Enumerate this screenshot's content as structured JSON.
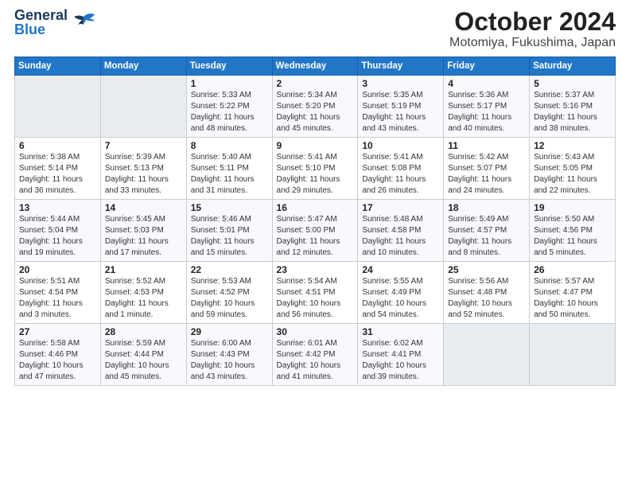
{
  "logo": {
    "name_part1": "General",
    "name_part2": "Blue"
  },
  "title": "October 2024",
  "subtitle": "Motomiya, Fukushima, Japan",
  "weekdays": [
    "Sunday",
    "Monday",
    "Tuesday",
    "Wednesday",
    "Thursday",
    "Friday",
    "Saturday"
  ],
  "weeks": [
    [
      {
        "day": "",
        "detail": ""
      },
      {
        "day": "",
        "detail": ""
      },
      {
        "day": "1",
        "detail": "Sunrise: 5:33 AM\nSunset: 5:22 PM\nDaylight: 11 hours and 48 minutes."
      },
      {
        "day": "2",
        "detail": "Sunrise: 5:34 AM\nSunset: 5:20 PM\nDaylight: 11 hours and 45 minutes."
      },
      {
        "day": "3",
        "detail": "Sunrise: 5:35 AM\nSunset: 5:19 PM\nDaylight: 11 hours and 43 minutes."
      },
      {
        "day": "4",
        "detail": "Sunrise: 5:36 AM\nSunset: 5:17 PM\nDaylight: 11 hours and 40 minutes."
      },
      {
        "day": "5",
        "detail": "Sunrise: 5:37 AM\nSunset: 5:16 PM\nDaylight: 11 hours and 38 minutes."
      }
    ],
    [
      {
        "day": "6",
        "detail": "Sunrise: 5:38 AM\nSunset: 5:14 PM\nDaylight: 11 hours and 36 minutes."
      },
      {
        "day": "7",
        "detail": "Sunrise: 5:39 AM\nSunset: 5:13 PM\nDaylight: 11 hours and 33 minutes."
      },
      {
        "day": "8",
        "detail": "Sunrise: 5:40 AM\nSunset: 5:11 PM\nDaylight: 11 hours and 31 minutes."
      },
      {
        "day": "9",
        "detail": "Sunrise: 5:41 AM\nSunset: 5:10 PM\nDaylight: 11 hours and 29 minutes."
      },
      {
        "day": "10",
        "detail": "Sunrise: 5:41 AM\nSunset: 5:08 PM\nDaylight: 11 hours and 26 minutes."
      },
      {
        "day": "11",
        "detail": "Sunrise: 5:42 AM\nSunset: 5:07 PM\nDaylight: 11 hours and 24 minutes."
      },
      {
        "day": "12",
        "detail": "Sunrise: 5:43 AM\nSunset: 5:05 PM\nDaylight: 11 hours and 22 minutes."
      }
    ],
    [
      {
        "day": "13",
        "detail": "Sunrise: 5:44 AM\nSunset: 5:04 PM\nDaylight: 11 hours and 19 minutes."
      },
      {
        "day": "14",
        "detail": "Sunrise: 5:45 AM\nSunset: 5:03 PM\nDaylight: 11 hours and 17 minutes."
      },
      {
        "day": "15",
        "detail": "Sunrise: 5:46 AM\nSunset: 5:01 PM\nDaylight: 11 hours and 15 minutes."
      },
      {
        "day": "16",
        "detail": "Sunrise: 5:47 AM\nSunset: 5:00 PM\nDaylight: 11 hours and 12 minutes."
      },
      {
        "day": "17",
        "detail": "Sunrise: 5:48 AM\nSunset: 4:58 PM\nDaylight: 11 hours and 10 minutes."
      },
      {
        "day": "18",
        "detail": "Sunrise: 5:49 AM\nSunset: 4:57 PM\nDaylight: 11 hours and 8 minutes."
      },
      {
        "day": "19",
        "detail": "Sunrise: 5:50 AM\nSunset: 4:56 PM\nDaylight: 11 hours and 5 minutes."
      }
    ],
    [
      {
        "day": "20",
        "detail": "Sunrise: 5:51 AM\nSunset: 4:54 PM\nDaylight: 11 hours and 3 minutes."
      },
      {
        "day": "21",
        "detail": "Sunrise: 5:52 AM\nSunset: 4:53 PM\nDaylight: 11 hours and 1 minute."
      },
      {
        "day": "22",
        "detail": "Sunrise: 5:53 AM\nSunset: 4:52 PM\nDaylight: 10 hours and 59 minutes."
      },
      {
        "day": "23",
        "detail": "Sunrise: 5:54 AM\nSunset: 4:51 PM\nDaylight: 10 hours and 56 minutes."
      },
      {
        "day": "24",
        "detail": "Sunrise: 5:55 AM\nSunset: 4:49 PM\nDaylight: 10 hours and 54 minutes."
      },
      {
        "day": "25",
        "detail": "Sunrise: 5:56 AM\nSunset: 4:48 PM\nDaylight: 10 hours and 52 minutes."
      },
      {
        "day": "26",
        "detail": "Sunrise: 5:57 AM\nSunset: 4:47 PM\nDaylight: 10 hours and 50 minutes."
      }
    ],
    [
      {
        "day": "27",
        "detail": "Sunrise: 5:58 AM\nSunset: 4:46 PM\nDaylight: 10 hours and 47 minutes."
      },
      {
        "day": "28",
        "detail": "Sunrise: 5:59 AM\nSunset: 4:44 PM\nDaylight: 10 hours and 45 minutes."
      },
      {
        "day": "29",
        "detail": "Sunrise: 6:00 AM\nSunset: 4:43 PM\nDaylight: 10 hours and 43 minutes."
      },
      {
        "day": "30",
        "detail": "Sunrise: 6:01 AM\nSunset: 4:42 PM\nDaylight: 10 hours and 41 minutes."
      },
      {
        "day": "31",
        "detail": "Sunrise: 6:02 AM\nSunset: 4:41 PM\nDaylight: 10 hours and 39 minutes."
      },
      {
        "day": "",
        "detail": ""
      },
      {
        "day": "",
        "detail": ""
      }
    ]
  ]
}
